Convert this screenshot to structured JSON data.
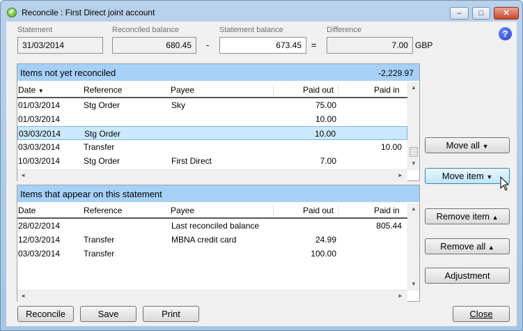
{
  "window": {
    "title": "Reconcile : First Direct joint account",
    "min_glyph": "–",
    "max_glyph": "□",
    "close_glyph": "✕"
  },
  "header": {
    "statement_label": "Statement",
    "statement_value": "31/03/2014",
    "reconciled_label": "Reconciled balance",
    "reconciled_value": "680.45",
    "minus": "-",
    "statement_balance_label": "Statement balance",
    "statement_balance_value": "673.45",
    "equals": "=",
    "difference_label": "Difference",
    "difference_value": "7.00",
    "currency": "GBP",
    "help": "?"
  },
  "unreconciled": {
    "title": "Items not yet reconciled",
    "total": "-2,229.97",
    "columns": {
      "date": "Date",
      "sort_glyph": "▼",
      "reference": "Reference",
      "payee": "Payee",
      "paid_out": "Paid out",
      "paid_in": "Paid in"
    },
    "rows": [
      {
        "date": "01/03/2014",
        "reference": "Stg Order",
        "payee": "Sky",
        "paid_out": "75.00",
        "paid_in": ""
      },
      {
        "date": "01/03/2014",
        "reference": "",
        "payee": "",
        "paid_out": "10.00",
        "paid_in": ""
      },
      {
        "date": "03/03/2014",
        "reference": "Stg Order",
        "payee": "",
        "paid_out": "10.00",
        "paid_in": ""
      },
      {
        "date": "03/03/2014",
        "reference": "Transfer",
        "payee": "",
        "paid_out": "",
        "paid_in": "10.00"
      },
      {
        "date": "10/03/2014",
        "reference": "Stg Order",
        "payee": "First Direct",
        "paid_out": "7.00",
        "paid_in": ""
      }
    ]
  },
  "statement_items": {
    "title": "Items that appear on this statement",
    "columns": {
      "date": "Date",
      "reference": "Reference",
      "payee": "Payee",
      "paid_out": "Paid out",
      "paid_in": "Paid in"
    },
    "rows": [
      {
        "date": "28/02/2014",
        "reference": "",
        "payee": "Last reconciled balance",
        "paid_out": "",
        "paid_in": "805.44"
      },
      {
        "date": "12/03/2014",
        "reference": "Transfer",
        "payee": "MBNA credit card",
        "paid_out": "24.99",
        "paid_in": ""
      },
      {
        "date": "03/03/2014",
        "reference": "Transfer",
        "payee": "",
        "paid_out": "100.00",
        "paid_in": ""
      }
    ]
  },
  "scroll": {
    "up": "▲",
    "down": "▼",
    "left": "◄",
    "right": "►"
  },
  "side_buttons": {
    "move_all": "Move all",
    "move_item": "Move item",
    "remove_item": "Remove item",
    "remove_all": "Remove all",
    "adjustment": "Adjustment",
    "down_caret": "▼",
    "up_caret": "▲"
  },
  "footer": {
    "reconcile": "Reconcile",
    "save": "Save",
    "print": "Print",
    "close": "Close"
  },
  "icons": {
    "title_icon": "green-check-icon",
    "help_icon": "help-question-icon",
    "cursor": "mouse-pointer-icon"
  }
}
